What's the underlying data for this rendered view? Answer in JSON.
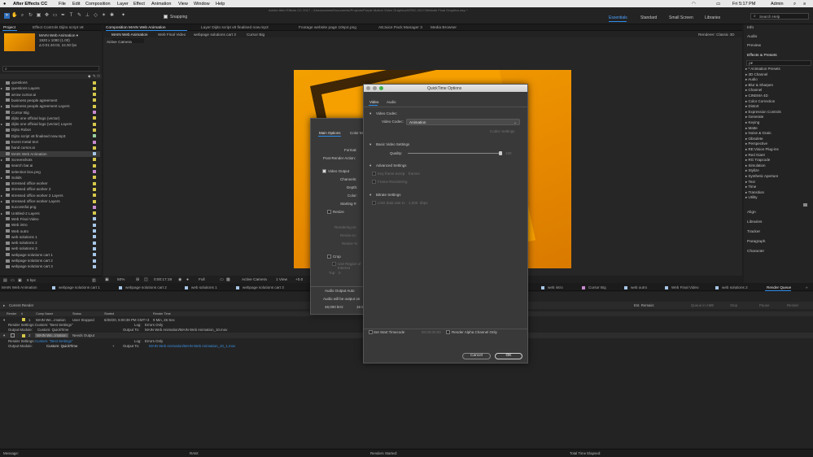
{
  "menubar": {
    "apple": "",
    "app": "After Effects CC",
    "items": [
      "File",
      "Edit",
      "Composition",
      "Layer",
      "Effect",
      "Animation",
      "View",
      "Window",
      "Help"
    ],
    "time": "Fri 5:17 PM",
    "user": "Admin"
  },
  "titlebar": "Adobe After Effects CC 2017 - /Users/admin/Documents/Projects/Purple Motion Video Graphics/MTBC.2017/Website Final Graphics.aep *",
  "toolbar": {
    "snapping": "Snapping",
    "workspaces": [
      "Essentials",
      "Standard",
      "Small Screen",
      "Libraries"
    ],
    "search_placeholder": "Search Help"
  },
  "project": {
    "tab": "Project",
    "effects_tab": "Effect Controls Dijito script v8",
    "comp_name": "MAIN Web Animation ▾",
    "comp_info1": "1920 x 1080 (1.00)",
    "comp_info2": "Δ 0:01:40:03, 24.00 fps",
    "items": [
      "questions",
      "questions Layers",
      "arrow cursor.ai",
      "business people agreement",
      "business people agreement Layers",
      "Cursor Big",
      "dijito one official logo (vector)",
      "dijito one official logo (vector) Layers",
      "Dijito Robot",
      "Dijito script v8 finalised now.mp3",
      "Event metal text",
      "hand cursor.ai",
      "MAIN Web Animation",
      "Screenshots",
      "search bar.ai",
      "selection box.png",
      "Solids",
      "stressed office worker",
      "stressed office worker 2",
      "stressed office worker 2 Layers",
      "stressed office worker Layers",
      "successful.png",
      "Untitled-2 Layers",
      "Web Final Video",
      "Web intro",
      "Web outro",
      "web solutions 1",
      "web solutions 2",
      "web solutions 3",
      "webpage solutions cart 1",
      "webpage solutions cart 2",
      "webpage solutions cart 3"
    ],
    "bpc": "8 bpc"
  },
  "viewer": {
    "tabs": [
      "Composition MAIN Web Animation",
      "Layer Dijito script v8 finalised now.mp3",
      "Footage website page 10sp4.png",
      "AEJuice Pack Manager 3",
      "Media Browser"
    ],
    "subtabs": [
      "MAIN Web Animation",
      "Web Final Video",
      "webpage solutions cart 3",
      "Cursor Big"
    ],
    "renderer": "Renderer: Classic 3D",
    "active_camera_label": "Active Camera",
    "zoom": "50%",
    "timecode": "0:00:17:19",
    "resolution": "Full",
    "camera": "Active Camera",
    "views": "1 View",
    "offset": "+0.0"
  },
  "right_panel": {
    "items": [
      "Info",
      "Audio",
      "Preview",
      "Effects & Presets"
    ],
    "fx_search": "ρ▾",
    "fx_items": [
      "* Animation Presets",
      "3D Channel",
      "Audio",
      "Blur & Sharpen",
      "Channel",
      "CINEMA 4D",
      "Color Correction",
      "Distort",
      "Expression Controls",
      "Generate",
      "Keying",
      "Matte",
      "Noise & Grain",
      "Obsolete",
      "Perspective",
      "RE:Vision Plug-ins",
      "Red Giant",
      "RG Trapcode",
      "Simulation",
      "Stylize",
      "Synthetic Aperture",
      "Text",
      "Time",
      "Transition",
      "Utility"
    ],
    "bottom": [
      "Align",
      "Libraries",
      "Tracker",
      "Paragraph",
      "Character"
    ]
  },
  "timeline_tabs": [
    "MAIN Web Animation",
    "webpage solutions cart 1",
    "webpage solutions cart 2",
    "web solutions 1",
    "webpage solutions cart 3",
    "",
    "web intro",
    "Cursor Big",
    "web outro",
    "Web Final Video",
    "web solutions 2",
    "Render Queue"
  ],
  "render_queue": {
    "current_render": "Current Render",
    "est_remain": "Est. Remain:",
    "buttons": [
      "Queue in AME",
      "Stop",
      "Pause",
      "Render"
    ],
    "headers": [
      "Render",
      "#",
      "Comp Name",
      "Status",
      "Started",
      "Render Time"
    ],
    "item1": {
      "num": "1",
      "comp": "MAIN We...imation",
      "status": "User Stopped",
      "started": "6/30/20, 5:00:39 PM CMT+3",
      "time": "9 Min, 26 Sec",
      "render_settings_label": "Render Settings:",
      "render_settings": "Custom: \"Best Settings\"",
      "log_label": "Log:",
      "log": "Errors Only",
      "output_module_label": "Output Module:",
      "output_module": "Custom: QuickTime",
      "output_to_label": "Output To:",
      "output_to": "MAIN Web Animation/MAIN Web Animation_10.mov"
    },
    "item2": {
      "num": "2",
      "comp": "MAIN We...imation",
      "status": "Needs Output",
      "render_settings_label": "Render Settings:",
      "render_settings": "Custom: \"Best Settings\"",
      "log_label": "Log:",
      "log": "Errors Only",
      "output_module_label": "Output Module:",
      "output_module": "Custom: QuickTime",
      "output_to_label": "Output To:",
      "output_to": "MAIN Web Animation/MAIN Web Animation_10_1.mov"
    }
  },
  "statusbar": {
    "message": "Message:",
    "ram": "RAM:",
    "renders_started": "Renders Started:",
    "total_time": "Total Time Elapsed:"
  },
  "output_module_dialog": {
    "tabs": [
      "Main Options",
      "Color M"
    ],
    "format": "Format:",
    "post_render": "Post-Render Action:",
    "video_output": "Video Output",
    "channels": "Channels:",
    "depth": "Depth:",
    "color": "Color:",
    "starting": "Starting #:",
    "resize": "Resize",
    "rendering_at": "Rendering at:",
    "resize_to": "Resize to:",
    "resize_pct": "Resize %:",
    "crop": "Crop",
    "use_roi": "Use Region of Interest",
    "top": "Top:",
    "top_val": "0",
    "audio_output": "Audio Output Auto",
    "audio_will": "Audio will be output on",
    "khz": "48,000 kHz",
    "bits": "16 Bi"
  },
  "quicktime_dialog": {
    "title": "QuickTime Options",
    "tabs": [
      "Video",
      "Audio"
    ],
    "video_codec_section": "Video Codec",
    "video_codec_label": "Video Codec:",
    "video_codec": "Animation",
    "codec_settings": "Codec Settings",
    "basic_section": "Basic Video Settings",
    "quality": "Quality:",
    "quality_val": "100",
    "quality_frac": 1.0,
    "advanced_section": "Advanced Settings",
    "key_frame": "Key frame every",
    "key_frame_val": "1",
    "key_frame_unit": "frames",
    "frame_reordering": "Frame Reordering",
    "bitrate_section": "Bitrate Settings",
    "limit_data": "Limit data rate to",
    "limit_val": "1,000",
    "limit_unit": "kbps",
    "set_start_tc": "Set Start Timecode",
    "start_tc_val": "00:00:00:00",
    "render_alpha": "Render Alpha Channel Only",
    "cancel": "Cancel",
    "ok": "OK"
  },
  "colors": {
    "accent": "#2d8ceb",
    "orange": "#f5a000",
    "panel": "#232323"
  }
}
